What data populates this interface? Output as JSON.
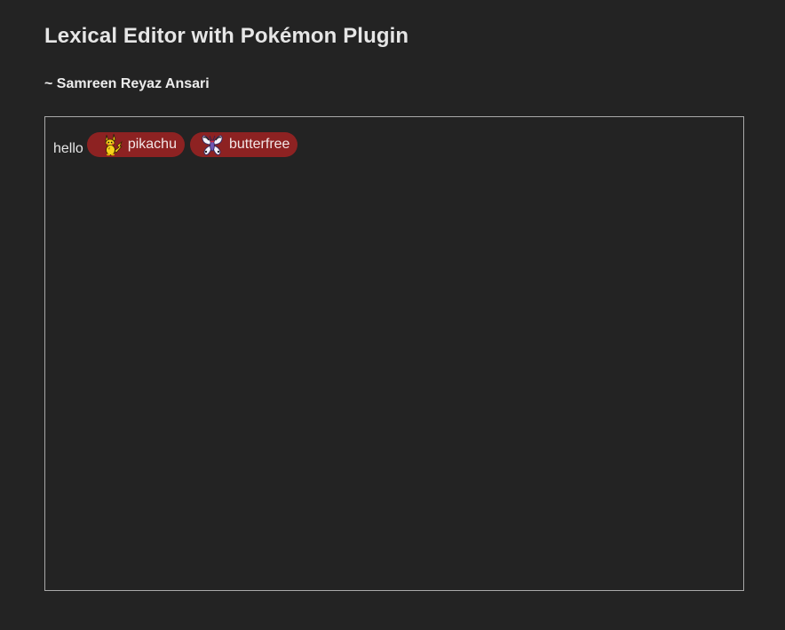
{
  "header": {
    "title": "Lexical Editor with Pokémon Plugin",
    "byline": "~ Samreen Reyaz Ansari"
  },
  "editor": {
    "text": "hello",
    "mentions": [
      {
        "label": "pikachu",
        "icon": "pikachu-icon"
      },
      {
        "label": "butterfree",
        "icon": "butterfree-icon"
      }
    ],
    "colors": {
      "background": "#232323",
      "border": "#a9a9a9",
      "chip": "#8d2222"
    }
  }
}
